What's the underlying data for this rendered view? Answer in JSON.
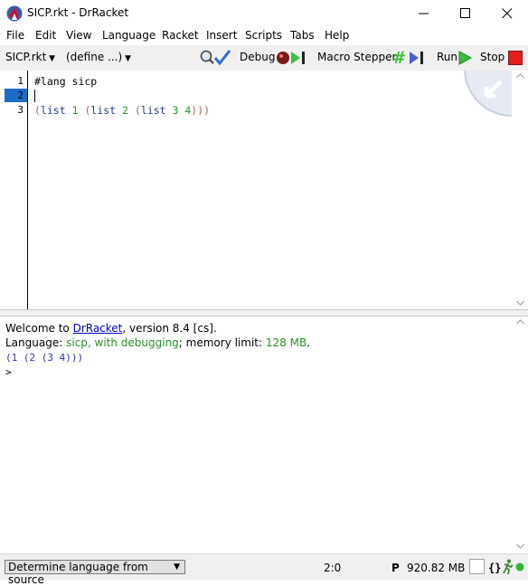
{
  "window": {
    "title": "SICP.rkt - DrRacket"
  },
  "menubar": {
    "items": [
      "File",
      "Edit",
      "View",
      "Language",
      "Racket",
      "Insert",
      "Scripts",
      "Tabs",
      "Help"
    ]
  },
  "toolbar": {
    "file_menu": "SICP.rkt",
    "define_menu": "(define ...)",
    "debug": "Debug",
    "macro_stepper": "Macro Stepper",
    "run": "Run",
    "stop": "Stop"
  },
  "editor": {
    "line_numbers": [
      "1",
      "2",
      "3"
    ],
    "current_line": "2",
    "lines": [
      {
        "segments": [
          {
            "text": "#lang sicp",
            "color": "#000000"
          }
        ]
      },
      {
        "segments": []
      },
      {
        "segments": [
          {
            "text": "(",
            "color": "#b26259"
          },
          {
            "text": "list",
            "color": "#263c8c"
          },
          {
            "text": " ",
            "color": "#000000"
          },
          {
            "text": "1",
            "color": "#2b8f2b"
          },
          {
            "text": " ",
            "color": "#000000"
          },
          {
            "text": "(",
            "color": "#b26259"
          },
          {
            "text": "list",
            "color": "#263c8c"
          },
          {
            "text": " ",
            "color": "#000000"
          },
          {
            "text": "2",
            "color": "#2b8f2b"
          },
          {
            "text": " ",
            "color": "#000000"
          },
          {
            "text": "(",
            "color": "#b26259"
          },
          {
            "text": "list",
            "color": "#263c8c"
          },
          {
            "text": " ",
            "color": "#000000"
          },
          {
            "text": "3",
            "color": "#2b8f2b"
          },
          {
            "text": " ",
            "color": "#000000"
          },
          {
            "text": "4",
            "color": "#2b8f2b"
          },
          {
            "text": ")))",
            "color": "#b26259"
          }
        ]
      }
    ]
  },
  "repl": {
    "welcome_prefix": "Welcome to ",
    "welcome_link": "DrRacket",
    "welcome_suffix": ", version 8.4 [cs].",
    "language_prefix": "Language: ",
    "language_name": "sicp, with debugging",
    "memory_prefix": "; memory limit: ",
    "memory_value": "128 MB",
    "memory_suffix": ".",
    "result": "(1 (2 (3 4)))",
    "prompt": ">"
  },
  "statusbar": {
    "language_select": "Determine language from source",
    "position": "2:0",
    "p_label": "P",
    "memory": "920.82 MB",
    "braces": "{}"
  },
  "colors": {
    "accent_blue": "#1c6cc9",
    "paren": "#b26259",
    "symbol": "#263c8c",
    "constant": "#2b8f2b",
    "repl_green": "#2b8f2b",
    "output_blue": "#3030b0",
    "link": "#0000cc",
    "stop_red": "#e02020",
    "run_green": "#3cbf3c"
  },
  "icons": {
    "app": "racket-logo-icon",
    "check_syntax": "check-syntax-icon",
    "debug": "debug-bug-icon",
    "macro": "macro-stepper-icon",
    "run": "run-arrow-icon",
    "stop": "stop-square-icon"
  }
}
